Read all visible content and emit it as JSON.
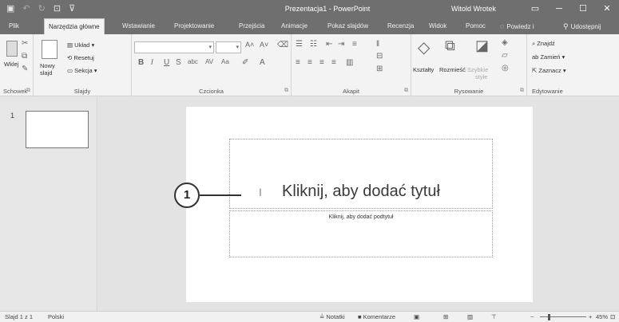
{
  "window": {
    "title": "Prezentacja1 - PowerPoint",
    "user": "Witold Wrotek",
    "quick_access": [
      "save-icon",
      "undo-icon",
      "redo-icon",
      "presentation-icon",
      "customize-icon"
    ]
  },
  "tabs": [
    {
      "label": "Plik"
    },
    {
      "label": "Narzędzia główne"
    },
    {
      "label": "Wstawianie"
    },
    {
      "label": "Projektowanie"
    },
    {
      "label": "Przejścia"
    },
    {
      "label": "Animacje"
    },
    {
      "label": "Pokaz slajdów"
    },
    {
      "label": "Recenzja"
    },
    {
      "label": "Widok"
    },
    {
      "label": "Pomoc"
    },
    {
      "label": "Powiedz i"
    },
    {
      "label": "Udostępnij"
    }
  ],
  "active_tab": 1,
  "ribbon": {
    "clipboard": {
      "label": "Schowek",
      "paste": "Wklej"
    },
    "slides": {
      "label": "Slajdy",
      "new_slide_1": "Nowy",
      "new_slide_2": "slajd",
      "layout": "Układ",
      "reset": "Resetuj",
      "section": "Sekcja"
    },
    "font": {
      "label": "Czcionka",
      "font_name": "",
      "font_size": ""
    },
    "paragraph": {
      "label": "Akapit"
    },
    "drawing": {
      "label": "Rysowanie",
      "shapes": "Kształty",
      "arrange": "Rozmieść",
      "quick_styles_1": "Szybkie",
      "quick_styles_2": "style"
    },
    "editing": {
      "label": "Edytowanie",
      "find": "Znajdź",
      "replace": "Zamień",
      "select": "Zaznacz"
    }
  },
  "thumbnails": {
    "slide_number": "1"
  },
  "slide": {
    "title_placeholder": "Kliknij, aby dodać tytuł",
    "subtitle_placeholder": "Kliknij, aby dodać podtytuł"
  },
  "callout": {
    "number": "1"
  },
  "status": {
    "slide_info": "Slajd 1 z 1",
    "language": "Polski",
    "notes": "Notatki",
    "comments": "Komentarze",
    "zoom": "45%",
    "zoom_level": 0.45
  }
}
